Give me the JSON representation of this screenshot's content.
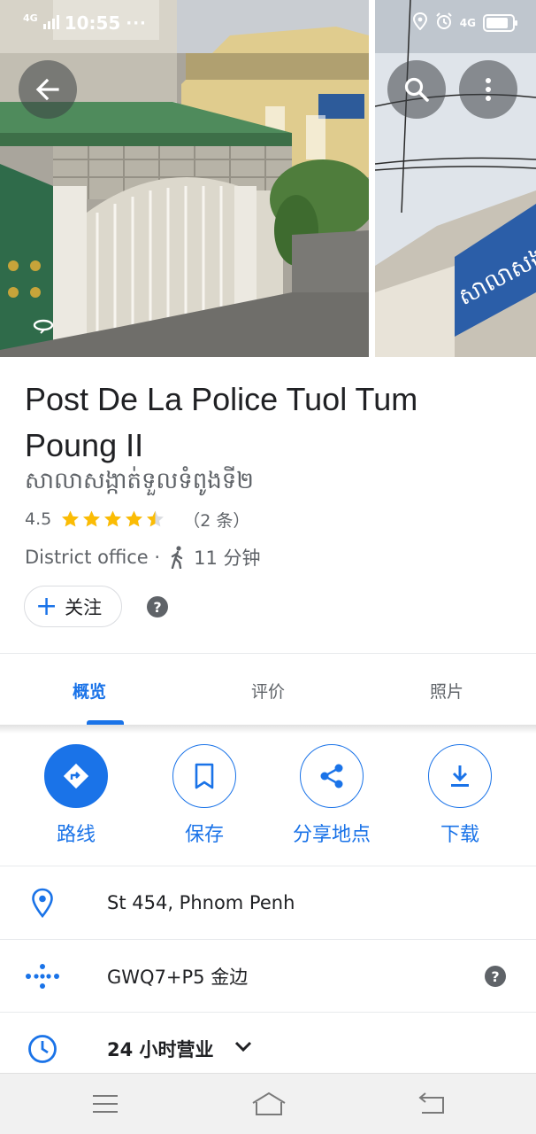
{
  "status_bar": {
    "network_left": "4G",
    "time": "10:55",
    "overflow": "···",
    "network_right": "4G",
    "battery_level": 0.85
  },
  "photos": {
    "sign_text": "សាលាសង្កាត់"
  },
  "place": {
    "name": "Post De La Police Tuol Tum Poung II",
    "local_name": "សាលាសង្កាត់ទួលទំពូងទី២",
    "rating": "4.5",
    "rating_value": 4.5,
    "review_count": "（2 条）",
    "category": "District office ·",
    "walk_time": "11 分钟"
  },
  "follow": {
    "plus": "+",
    "label": "关注"
  },
  "help_glyph": "?",
  "tabs": [
    {
      "label": "概览",
      "active": true
    },
    {
      "label": "评价",
      "active": false
    },
    {
      "label": "照片",
      "active": false
    }
  ],
  "actions": [
    {
      "label": "路线",
      "icon": "directions-icon"
    },
    {
      "label": "保存",
      "icon": "bookmark-icon"
    },
    {
      "label": "分享地点",
      "icon": "share-icon"
    },
    {
      "label": "下载",
      "icon": "download-icon"
    }
  ],
  "info": {
    "address": "St 454, Phnom Penh",
    "plus_code": "GWQ7+P5 金边",
    "hours": "24 小时营业"
  },
  "colors": {
    "accent": "#1a73e8",
    "star": "#fbbc04",
    "secondary_text": "#5f6368"
  }
}
